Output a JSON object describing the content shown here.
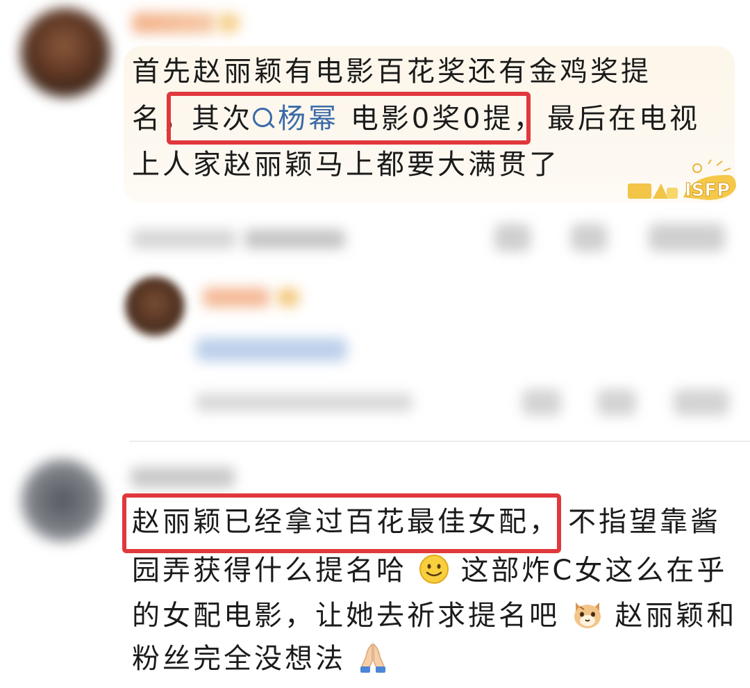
{
  "comment1": {
    "line1": "首先赵丽颖有电影百花奖还有金鸡奖提",
    "line2_before": "名，",
    "line2_highlight_prefix": "其次",
    "line2_link": "杨幂",
    "line2_highlight_suffix": " 电影0奖0提，",
    "line2_after": "最后在电视",
    "line3": "上人家赵丽颖马上都要大满贯了",
    "badge_text": "ISFP",
    "search_icon": "search-icon",
    "accent": "#e0383c",
    "link_color": "#3a6aa8"
  },
  "comment2": {
    "line1_highlight": "赵丽颖已经拿过百花最佳女配，",
    "line1_after": "不指望靠酱",
    "line2_before": "园弄获得什么提名哈",
    "line2_after": "这部炸C女这么在乎",
    "line3_before": "的女配电影，让她去祈求提名吧",
    "line3_after": "赵丽颖和",
    "line4": "粉丝完全没想法",
    "emoji1": "slightly-smiling-face-icon",
    "emoji2": "cat-face-icon",
    "emoji3": "folded-hands-icon"
  }
}
